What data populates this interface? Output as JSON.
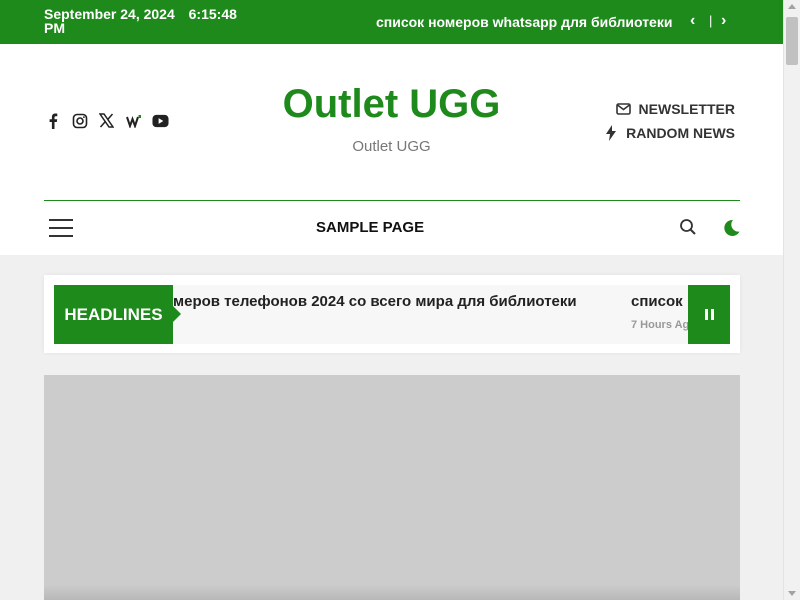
{
  "topbar": {
    "date": "September 24, 2024",
    "time": "6:15:48 PM",
    "ticker": "список номеров whatsapp для библиотеки",
    "prev_icon": "chevron-left",
    "next_icon": "chevron-right",
    "separator": "|"
  },
  "header": {
    "socials": [
      "facebook-icon",
      "instagram-icon",
      "x-icon",
      "w-icon",
      "youtube-icon"
    ],
    "title": "Outlet UGG",
    "tagline": "Outlet UGG",
    "newsletter_label": "NEWSLETTER",
    "random_label": "RANDOM NEWS"
  },
  "nav": {
    "menu_item": "SAMPLE PAGE"
  },
  "headlines": {
    "label": "HEADLINES",
    "item1": "меров телефонов 2024 со всего мира для библиотеки",
    "item2": "список",
    "item2_time": "7 Hours Ag"
  },
  "colors": {
    "accent": "#1f8a1c"
  }
}
